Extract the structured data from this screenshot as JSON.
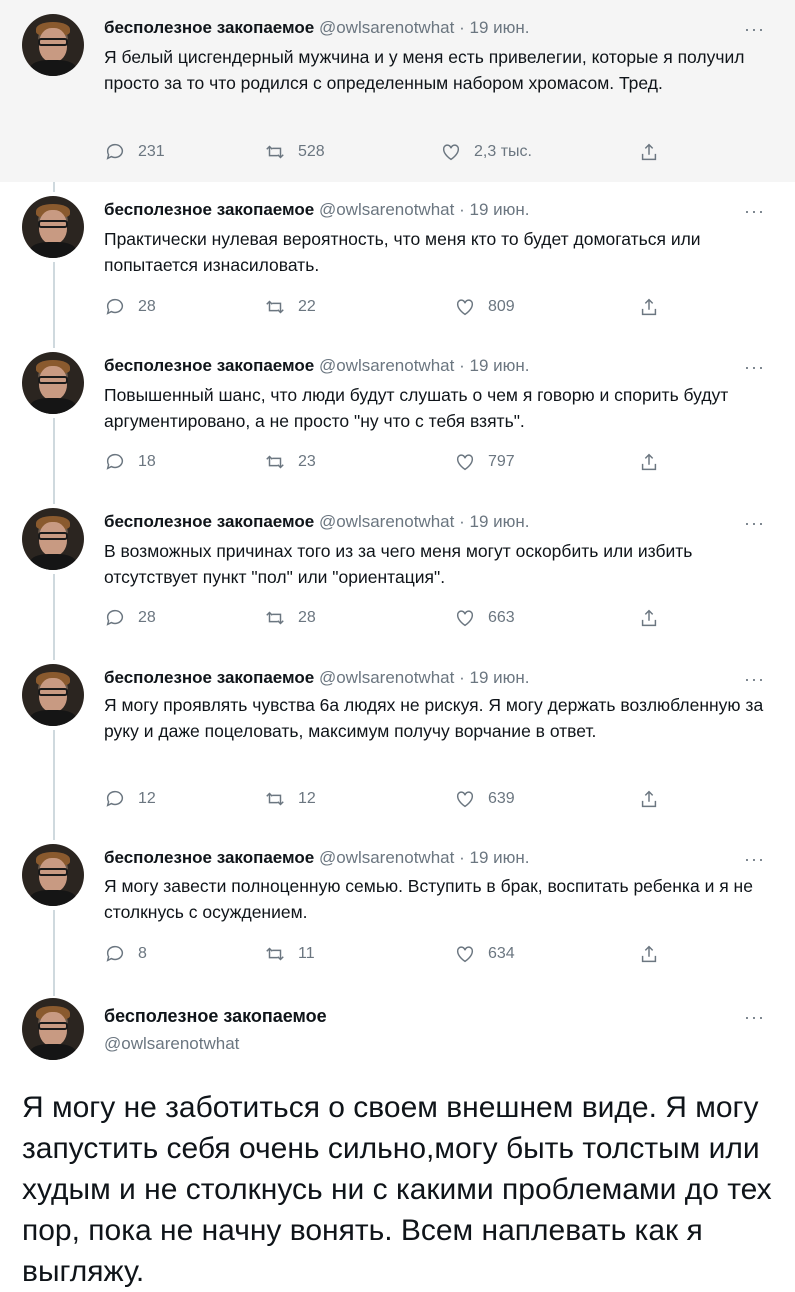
{
  "author": {
    "name": "бесполезное закопаемое",
    "handle": "@owlsarenotwhat",
    "date": "19 июн."
  },
  "more_glyph": "···",
  "tweets": [
    {
      "text": "Я белый цисгендерный мужчина и у меня есть привелегии, которые я получил просто за то что родился с определенным набором хромасом. Тред.",
      "replies": "231",
      "retweets": "528",
      "likes": "2,3 тыс."
    },
    {
      "text": "Практически нулевая вероятность, что меня кто то будет домогаться или попытается изнасиловать.",
      "replies": "28",
      "retweets": "22",
      "likes": "809"
    },
    {
      "text": "Повышенный шанс, что люди будут слушать о чем я говорю и спорить будут аргументировано, а не просто \"ну что с тебя взять\".",
      "replies": "18",
      "retweets": "23",
      "likes": "797"
    },
    {
      "text": "В возможных причинах того из за чего меня могут оскорбить или избить отсутствует пункт \"пол\" или \"ориентация\".",
      "replies": "28",
      "retweets": "28",
      "likes": "663"
    },
    {
      "text": "Я могу проявлять чувства 6а людях не рискуя. Я могу держать возлюбленную за руку и даже поцеловать, максимум получу ворчание в ответ.",
      "replies": "12",
      "retweets": "12",
      "likes": "639"
    },
    {
      "text": "Я могу завести полноценную семью. Вступить в брак, воспитать ребенка и я не столкнусь с осуждением.",
      "replies": "8",
      "retweets": "11",
      "likes": "634"
    }
  ],
  "focused": {
    "text": "Я могу не заботиться о своем внешнем виде. Я могу запустить себя очень сильно,могу быть толстым или худым и не столкнусь ни с какими проблемами до тех пор, пока не начну вонять. Всем наплевать как я выгляжу."
  }
}
